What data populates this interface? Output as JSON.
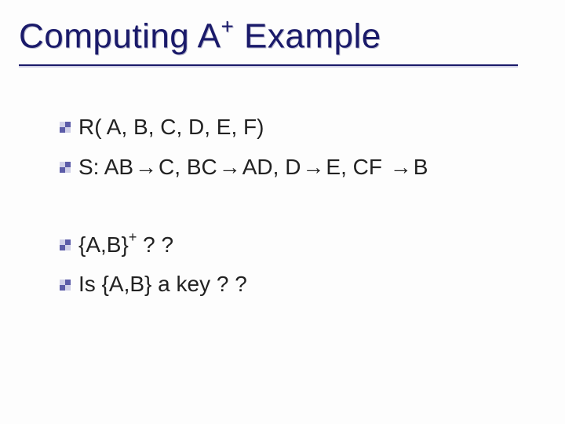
{
  "title": {
    "part1": "Computing A",
    "sup": "+",
    "part2": " Example"
  },
  "bullets": [
    {
      "kind": "line",
      "html": "R( A, B, C, D, E, F)"
    },
    {
      "kind": "line",
      "html": "S: AB<span class='arrow'>&#8594;</span>C, BC<span class='arrow'>&#8594;</span>AD, D<span class='arrow'>&#8594;</span>E, CF <span class='arrow'>&#8594;</span>B"
    },
    {
      "kind": "spacer"
    },
    {
      "kind": "line",
      "html": "{A,B}<span class='sup2'>+</span> ? ?"
    },
    {
      "kind": "line",
      "html": "Is {A,B} a key ? ?"
    }
  ]
}
